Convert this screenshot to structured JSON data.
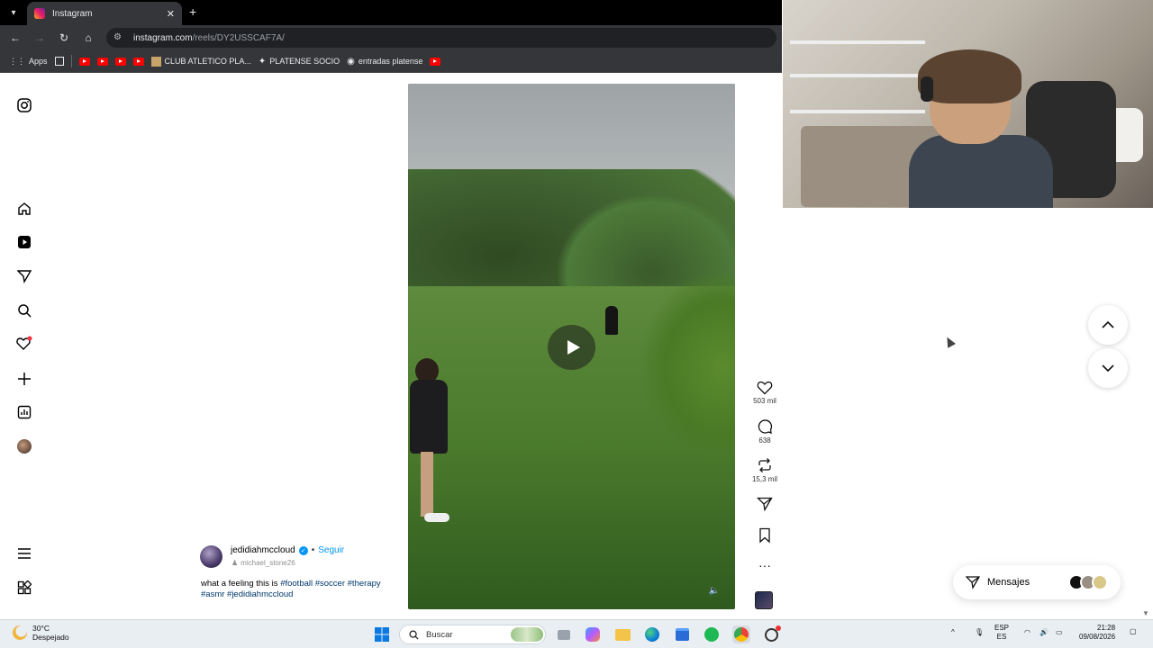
{
  "browser": {
    "tab_title": "Instagram",
    "url_domain": "instagram.com",
    "url_path": "/reels/DY2USSCAF7A/",
    "bookmarks": [
      {
        "label": "Apps"
      },
      {
        "label": "CLUB ATLETICO PLA..."
      },
      {
        "label": "PLATENSE SOCIO"
      },
      {
        "label": "entradas platense"
      }
    ]
  },
  "reel": {
    "author": "jedidiahmccloud",
    "follow_label": "Seguir",
    "audio_label": "michael_stone26",
    "caption_text": "what a feeling this is",
    "caption_tags": "#football #soccer #therapy #asmr #jedidiahmccloud",
    "likes": "503 mil",
    "comments": "638",
    "reposts": "15,3 mil"
  },
  "messages": {
    "label": "Mensajes"
  },
  "taskbar": {
    "temperature": "30°C",
    "weather": "Despejado",
    "search_label": "Buscar",
    "lang_line1": "ESP",
    "lang_line2": "ES",
    "time": "21:28",
    "date": "09/08/2026"
  },
  "colors": {
    "ig_blue": "#0095f6",
    "notification_red": "#ff3040",
    "chrome_dark": "#202124"
  }
}
